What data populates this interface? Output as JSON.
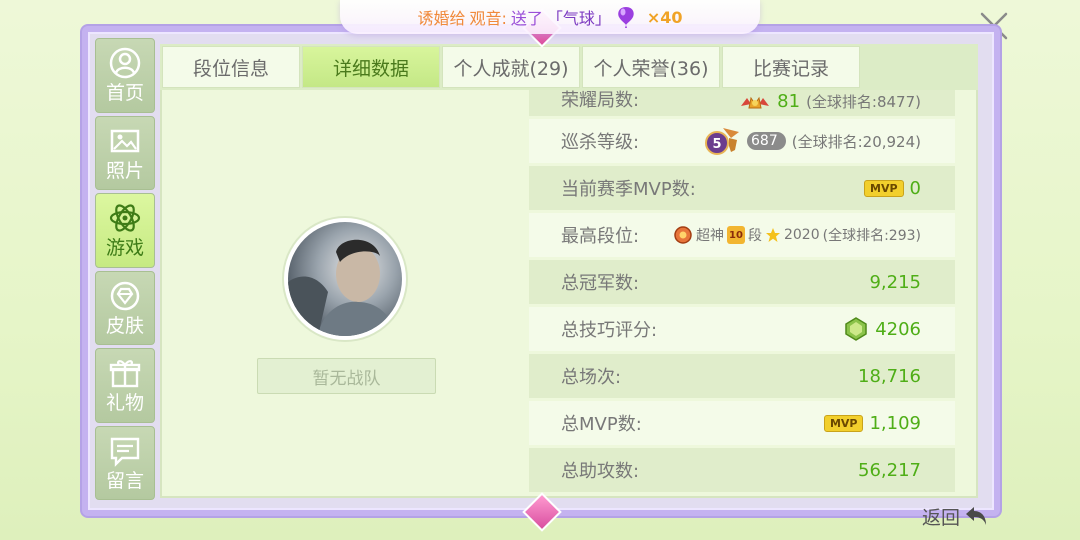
{
  "announcement": {
    "sender": "诱婚给",
    "receiver": "观音:",
    "verb": "送了",
    "gift": "「气球」",
    "count": "×40",
    "icon": "balloon-icon"
  },
  "sidebar": {
    "items": [
      {
        "label": "首页",
        "icon": "user-circle-icon"
      },
      {
        "label": "照片",
        "icon": "photo-icon"
      },
      {
        "label": "游戏",
        "icon": "atom-icon",
        "active": true
      },
      {
        "label": "皮肤",
        "icon": "diamond-ring-icon"
      },
      {
        "label": "礼物",
        "icon": "gift-icon"
      },
      {
        "label": "留言",
        "icon": "message-icon"
      }
    ]
  },
  "tabs": [
    {
      "label": "段位信息"
    },
    {
      "label": "详细数据",
      "active": true
    },
    {
      "label": "个人成就(29)"
    },
    {
      "label": "个人荣誉(36)"
    },
    {
      "label": "比赛记录"
    }
  ],
  "profile": {
    "team_label": "暂无战队"
  },
  "stats": [
    {
      "label": "荣耀局数:",
      "value": "81",
      "extra": "(全球排名:8477)",
      "icon": "crown-wings-icon"
    },
    {
      "label": "巡杀等级:",
      "value": "687",
      "extra": "(全球排名:20,924)",
      "icon": "level-5-badge-icon"
    },
    {
      "label": "当前赛季MVP数:",
      "value": "0",
      "badge": "MVP"
    },
    {
      "label": "最高段位:",
      "rank1": "超神",
      "rank2": "段",
      "rank_level": "10",
      "stars": "2020",
      "extra": "(全球排名:293)"
    },
    {
      "label": "总冠军数:",
      "value": "9,215"
    },
    {
      "label": "总技巧评分:",
      "value": "4206",
      "icon": "green-gem-icon"
    },
    {
      "label": "总场次:",
      "value": "18,716"
    },
    {
      "label": "总MVP数:",
      "value": "1,109",
      "badge": "MVP"
    },
    {
      "label": "总助攻数:",
      "value": "56,217"
    }
  ],
  "back_label": "返回",
  "colors": {
    "accent": "#4fae17",
    "frame": "#c4b2f0",
    "active_tab": "#c4e886"
  }
}
